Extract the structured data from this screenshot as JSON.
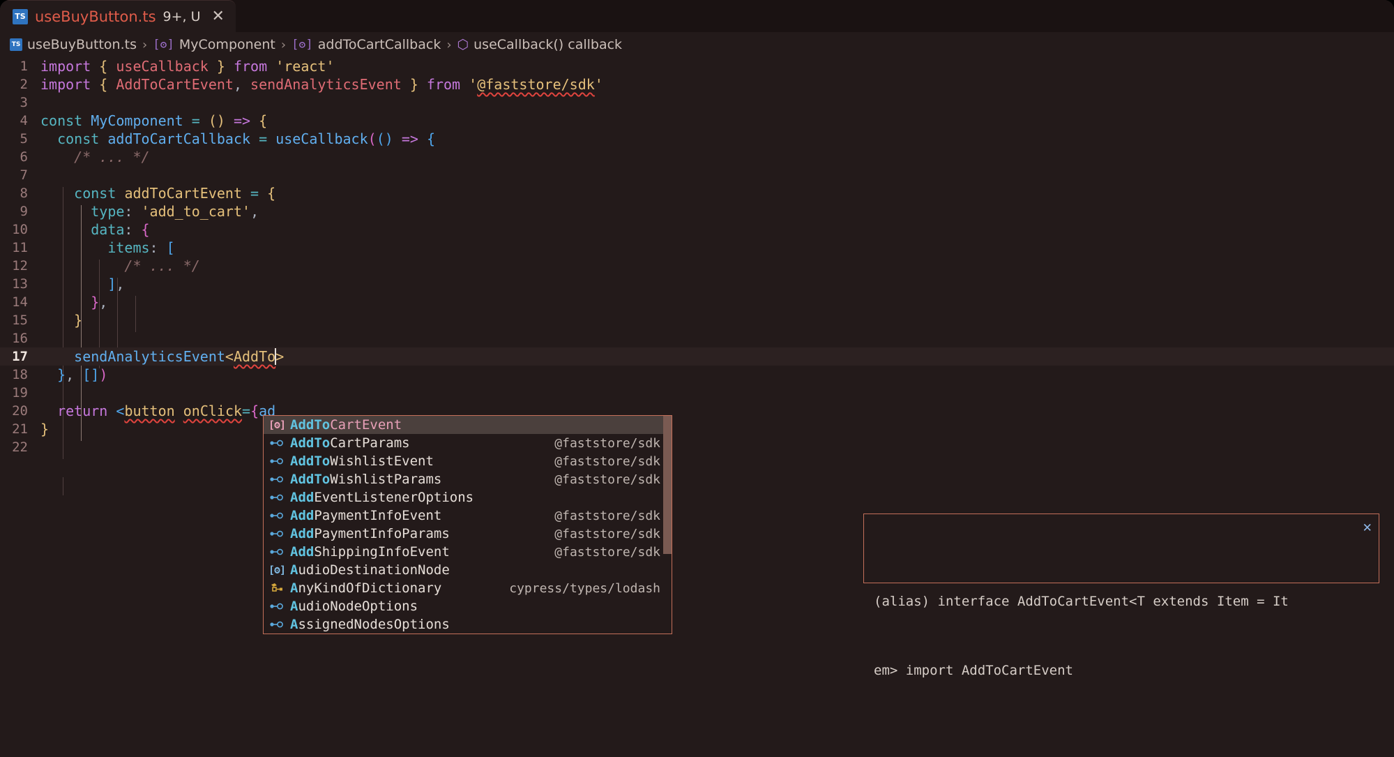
{
  "window": {
    "background": "#231a1a",
    "accent": "#c4705a"
  },
  "tab": {
    "icon": "typescript-file-icon",
    "icon_text": "TS",
    "label": "useBuyButton.ts",
    "badge": "9+, U",
    "close": "✕"
  },
  "breadcrumbs": {
    "separator": "›",
    "items": [
      {
        "icon": "typescript-file-icon",
        "icon_text": "TS",
        "label": "useBuyButton.ts"
      },
      {
        "icon": "method-symbol-icon",
        "icon_text": "[ʘ]",
        "label": "MyComponent"
      },
      {
        "icon": "method-symbol-icon",
        "icon_text": "[ʘ]",
        "label": "addToCartCallback"
      },
      {
        "icon": "module-symbol-icon",
        "icon_text": "⬡",
        "label": "useCallback() callback"
      }
    ]
  },
  "editor": {
    "active_line": 17,
    "lines": [
      {
        "n": "1"
      },
      {
        "n": "2"
      },
      {
        "n": "3"
      },
      {
        "n": "4"
      },
      {
        "n": "5"
      },
      {
        "n": "6"
      },
      {
        "n": "7"
      },
      {
        "n": "8"
      },
      {
        "n": "9"
      },
      {
        "n": "10"
      },
      {
        "n": "11"
      },
      {
        "n": "12"
      },
      {
        "n": "13"
      },
      {
        "n": "14"
      },
      {
        "n": "15"
      },
      {
        "n": "16"
      },
      {
        "n": "17"
      },
      {
        "n": "18"
      },
      {
        "n": "19"
      },
      {
        "n": "20"
      },
      {
        "n": "21"
      },
      {
        "n": "22"
      }
    ],
    "source": [
      "import { useCallback } from 'react'",
      "import { AddToCartEvent, sendAnalyticsEvent } from '@faststore/sdk'",
      "",
      "const MyComponent = () => {",
      "  const addToCartCallback = useCallback(() => {",
      "    /* ... */",
      "",
      "    const addToCartEvent = {",
      "      type: 'add_to_cart',",
      "      data: {",
      "        items: [",
      "          /* ... */",
      "        ],",
      "      },",
      "    }",
      "",
      "    sendAnalyticsEvent<AddTo>",
      "  }, [])",
      "",
      "  return <button onClick={ad",
      "}",
      ""
    ]
  },
  "suggest": {
    "selected_index": 0,
    "items": [
      {
        "icon": "interface-symbol-icon",
        "glyph": "[ʘ]",
        "icon_kind": "pink",
        "match": "AddTo",
        "rest": "CartEvent",
        "rest_kind": "pink",
        "detail": ""
      },
      {
        "icon": "interface-symbol-icon",
        "glyph": "ref",
        "icon_kind": "blue",
        "match": "AddTo",
        "rest": "CartParams",
        "rest_kind": "plain",
        "detail": "@faststore/sdk"
      },
      {
        "icon": "interface-symbol-icon",
        "glyph": "ref",
        "icon_kind": "blue",
        "match": "AddTo",
        "rest": "WishlistEvent",
        "rest_kind": "plain",
        "detail": "@faststore/sdk"
      },
      {
        "icon": "interface-symbol-icon",
        "glyph": "ref",
        "icon_kind": "blue",
        "match": "AddTo",
        "rest": "WishlistParams",
        "rest_kind": "plain",
        "detail": "@faststore/sdk"
      },
      {
        "icon": "interface-symbol-icon",
        "glyph": "ref",
        "icon_kind": "blue",
        "match": "Add",
        "rest": "EventListenerOptions",
        "rest_kind": "plain",
        "detail": ""
      },
      {
        "icon": "interface-symbol-icon",
        "glyph": "ref",
        "icon_kind": "blue",
        "match": "Add",
        "rest": "PaymentInfoEvent",
        "rest_kind": "plain",
        "detail": "@faststore/sdk"
      },
      {
        "icon": "interface-symbol-icon",
        "glyph": "ref",
        "icon_kind": "blue",
        "match": "Add",
        "rest": "PaymentInfoParams",
        "rest_kind": "plain",
        "detail": "@faststore/sdk"
      },
      {
        "icon": "interface-symbol-icon",
        "glyph": "ref",
        "icon_kind": "blue",
        "match": "Add",
        "rest": "ShippingInfoEvent",
        "rest_kind": "plain",
        "detail": "@faststore/sdk"
      },
      {
        "icon": "class-symbol-icon",
        "glyph": "[ʘ]",
        "icon_kind": "blue",
        "match": "A",
        "rest": "udioDestinationNode",
        "rest_kind": "plain",
        "detail": ""
      },
      {
        "icon": "type-parameter-symbol-icon",
        "glyph": "struct",
        "icon_kind": "gold",
        "match": "A",
        "rest": "nyKindOfDictionary",
        "rest_kind": "plain",
        "detail": "cypress/types/lodash"
      },
      {
        "icon": "interface-symbol-icon",
        "glyph": "ref",
        "icon_kind": "blue",
        "match": "A",
        "rest": "udioNodeOptions",
        "rest_kind": "plain",
        "detail": ""
      },
      {
        "icon": "interface-symbol-icon",
        "glyph": "ref",
        "icon_kind": "blue",
        "match": "A",
        "rest": "ssignedNodesOptions",
        "rest_kind": "plain",
        "detail": ""
      }
    ]
  },
  "docs": {
    "line1": "(alias) interface AddToCartEvent<T extends Item = It",
    "line2": "em> import AddToCartEvent",
    "close": "✕"
  }
}
